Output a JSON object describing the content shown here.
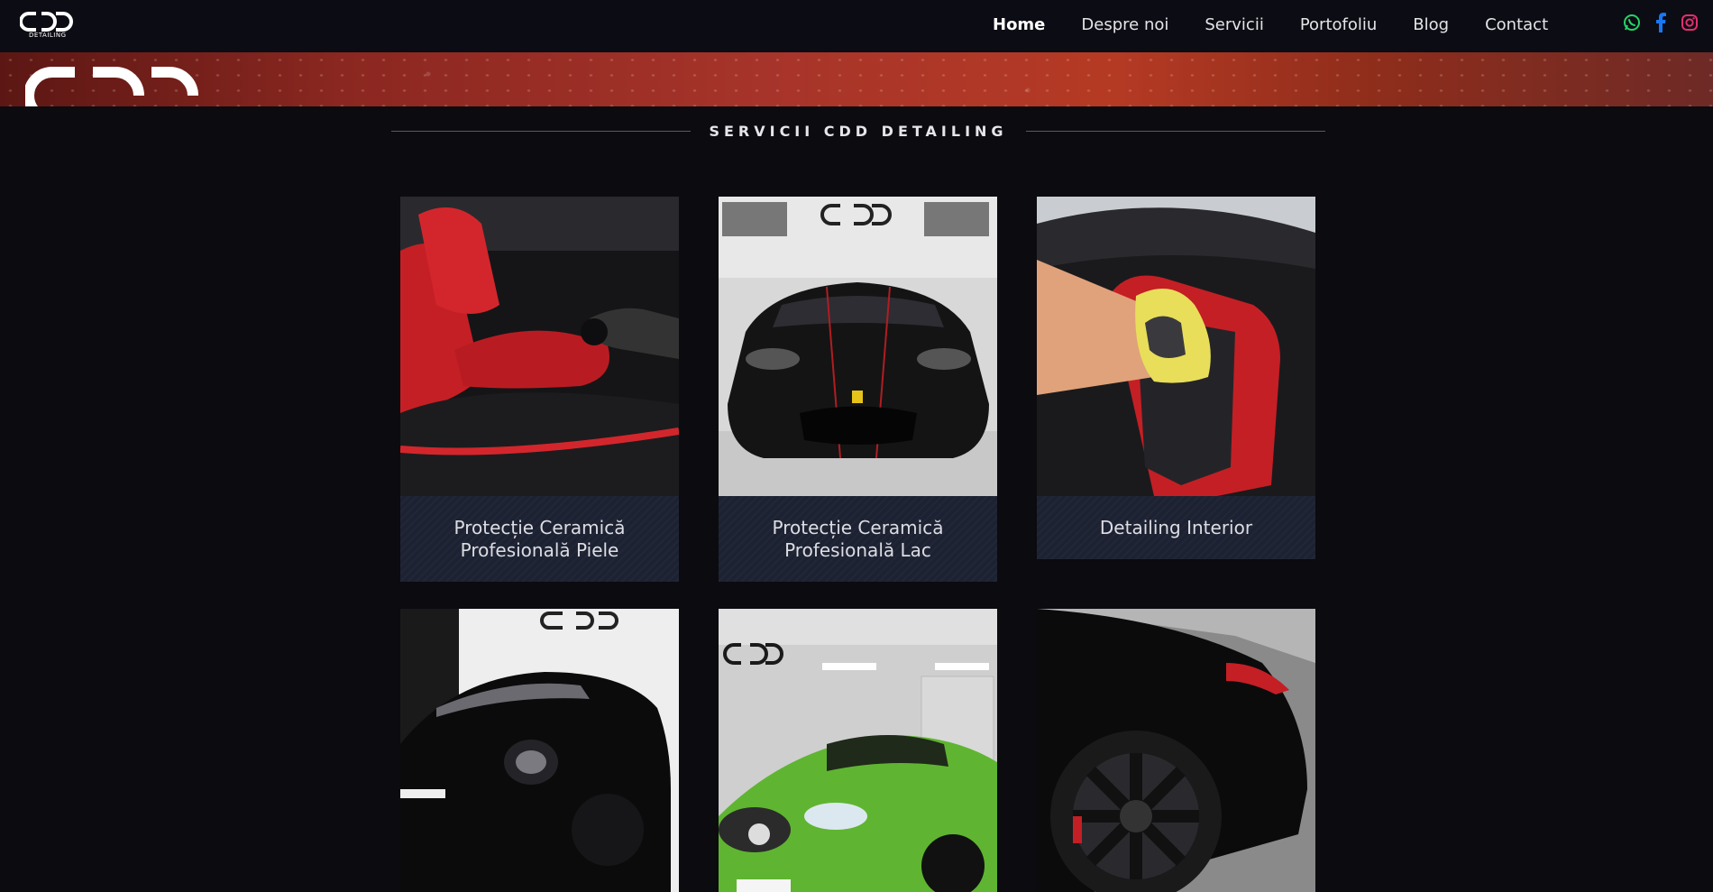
{
  "brand": {
    "logo_text": "CDD",
    "logo_subtext": "DETAILING"
  },
  "nav": {
    "items": [
      {
        "label": "Home",
        "active": true
      },
      {
        "label": "Despre noi"
      },
      {
        "label": "Servicii"
      },
      {
        "label": "Portofoliu"
      },
      {
        "label": "Blog"
      },
      {
        "label": "Contact"
      }
    ]
  },
  "social": [
    {
      "icon": "whatsapp-icon",
      "color": "#25d366"
    },
    {
      "icon": "facebook-icon",
      "color": "#1877f2"
    },
    {
      "icon": "instagram-icon",
      "color": "#e1306c"
    }
  ],
  "section": {
    "title": "SERVICII CDD DETAILING"
  },
  "services": [
    {
      "title": "Protecție Ceramică Profesională Piele",
      "image": "red leather car seat being wiped"
    },
    {
      "title": "Protecție Ceramică Profesională Lac",
      "image": "black Ferrari front in studio"
    },
    {
      "title": "Detailing Interior",
      "image": "hand cleaning red car seat with yellow cloth"
    },
    {
      "title": "",
      "image": "black Porsche 911 in studio"
    },
    {
      "title": "",
      "image": "green Mercedes in garage"
    },
    {
      "title": "",
      "image": "black SUV wheel close-up"
    }
  ],
  "colors": {
    "background": "#0b0b10",
    "header": "#0c0c14",
    "caption": "#1d2233",
    "accent_red": "#c8202a"
  }
}
